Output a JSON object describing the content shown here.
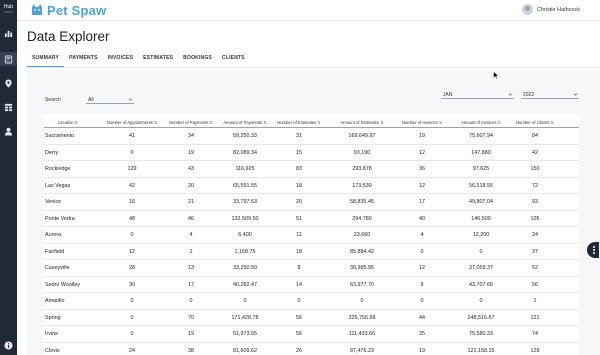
{
  "rail": {
    "hub_label": "Hub",
    "hub_sub": "Admin"
  },
  "brand": {
    "name": "Pet Spaw"
  },
  "user": {
    "name": "Christie Hathcock"
  },
  "page": {
    "title": "Data Explorer"
  },
  "tabs": [
    {
      "label": "SUMMARY",
      "active": true
    },
    {
      "label": "PAYMENTS",
      "active": false
    },
    {
      "label": "INVOICES",
      "active": false
    },
    {
      "label": "ESTIMATES",
      "active": false
    },
    {
      "label": "BOOKINGS",
      "active": false
    },
    {
      "label": "CLIENTS",
      "active": false
    }
  ],
  "filters": {
    "search_label": "Search",
    "search_value": "All",
    "month_value": "JAN",
    "year_value": "2022"
  },
  "table": {
    "columns": [
      "Location",
      "Number of Appointments",
      "Number of Payments",
      "Amount of Payments",
      "Number of Estimates",
      "Amount of Estimates",
      "Number of Invoices",
      "Amount of Invoices",
      "Number of Clients"
    ],
    "rows": [
      [
        "Sacramento",
        "41",
        "34",
        "59,250.33",
        "31",
        "169,649.97",
        "19",
        "75,607.94",
        "84"
      ],
      [
        "Derry",
        "0",
        "19",
        "82,089.34",
        "15",
        "93,190",
        "12",
        "147,880",
        "42"
      ],
      [
        "Rockledge",
        "129",
        "43",
        "116,925",
        "83",
        "293,878",
        "36",
        "97,625",
        "150"
      ],
      [
        "Las Vegas",
        "42",
        "20",
        "65,591.55",
        "18",
        "173,539",
        "12",
        "56,518.55",
        "72"
      ],
      [
        "Venice",
        "16",
        "21",
        "33,797.63",
        "20",
        "58,835.45",
        "17",
        "49,807.04",
        "93"
      ],
      [
        "Ponte Vedra",
        "48",
        "46",
        "132,509.50",
        "51",
        "294,780",
        "40",
        "146,500",
        "105"
      ],
      [
        "Aurora",
        "0",
        "4",
        "6,400",
        "11",
        "23,660",
        "4",
        "12,200",
        "24"
      ],
      [
        "Fairfield",
        "12",
        "1",
        "1,168.75",
        "18",
        "85,884.42",
        "0",
        "0",
        "37"
      ],
      [
        "Caseyville",
        "28",
        "13",
        "33,250.50",
        "8",
        "39,995.95",
        "12",
        "37,059.37",
        "52"
      ],
      [
        "Sedro Woolley",
        "30",
        "17",
        "40,282.47",
        "14",
        "63,977.70",
        "9",
        "43,707.66",
        "56"
      ],
      [
        "Amarillo",
        "0",
        "0",
        "0",
        "0",
        "0",
        "0",
        "0",
        "1"
      ],
      [
        "Spring",
        "0",
        "70",
        "171,428.78",
        "56",
        "325,756.68",
        "44",
        "248,516.67",
        "121"
      ],
      [
        "Irvine",
        "0",
        "19",
        "51,973.65",
        "56",
        "111,433.66",
        "25",
        "75,580.33",
        "74"
      ],
      [
        "Clovis",
        "24",
        "38",
        "81,609.62",
        "26",
        "87,476.23",
        "19",
        "121,158.15",
        "129"
      ]
    ]
  },
  "colors": {
    "accent": "#4aa3d8",
    "rail": "#1f2937",
    "content_bg": "#f6f7f9"
  },
  "icons": [
    "chart-bar-icon",
    "calculator-icon",
    "location-pin-icon",
    "grid-icon",
    "user-icon",
    "info-icon",
    "cat-logo-icon",
    "chevron-down-icon",
    "more-vertical-icon"
  ]
}
